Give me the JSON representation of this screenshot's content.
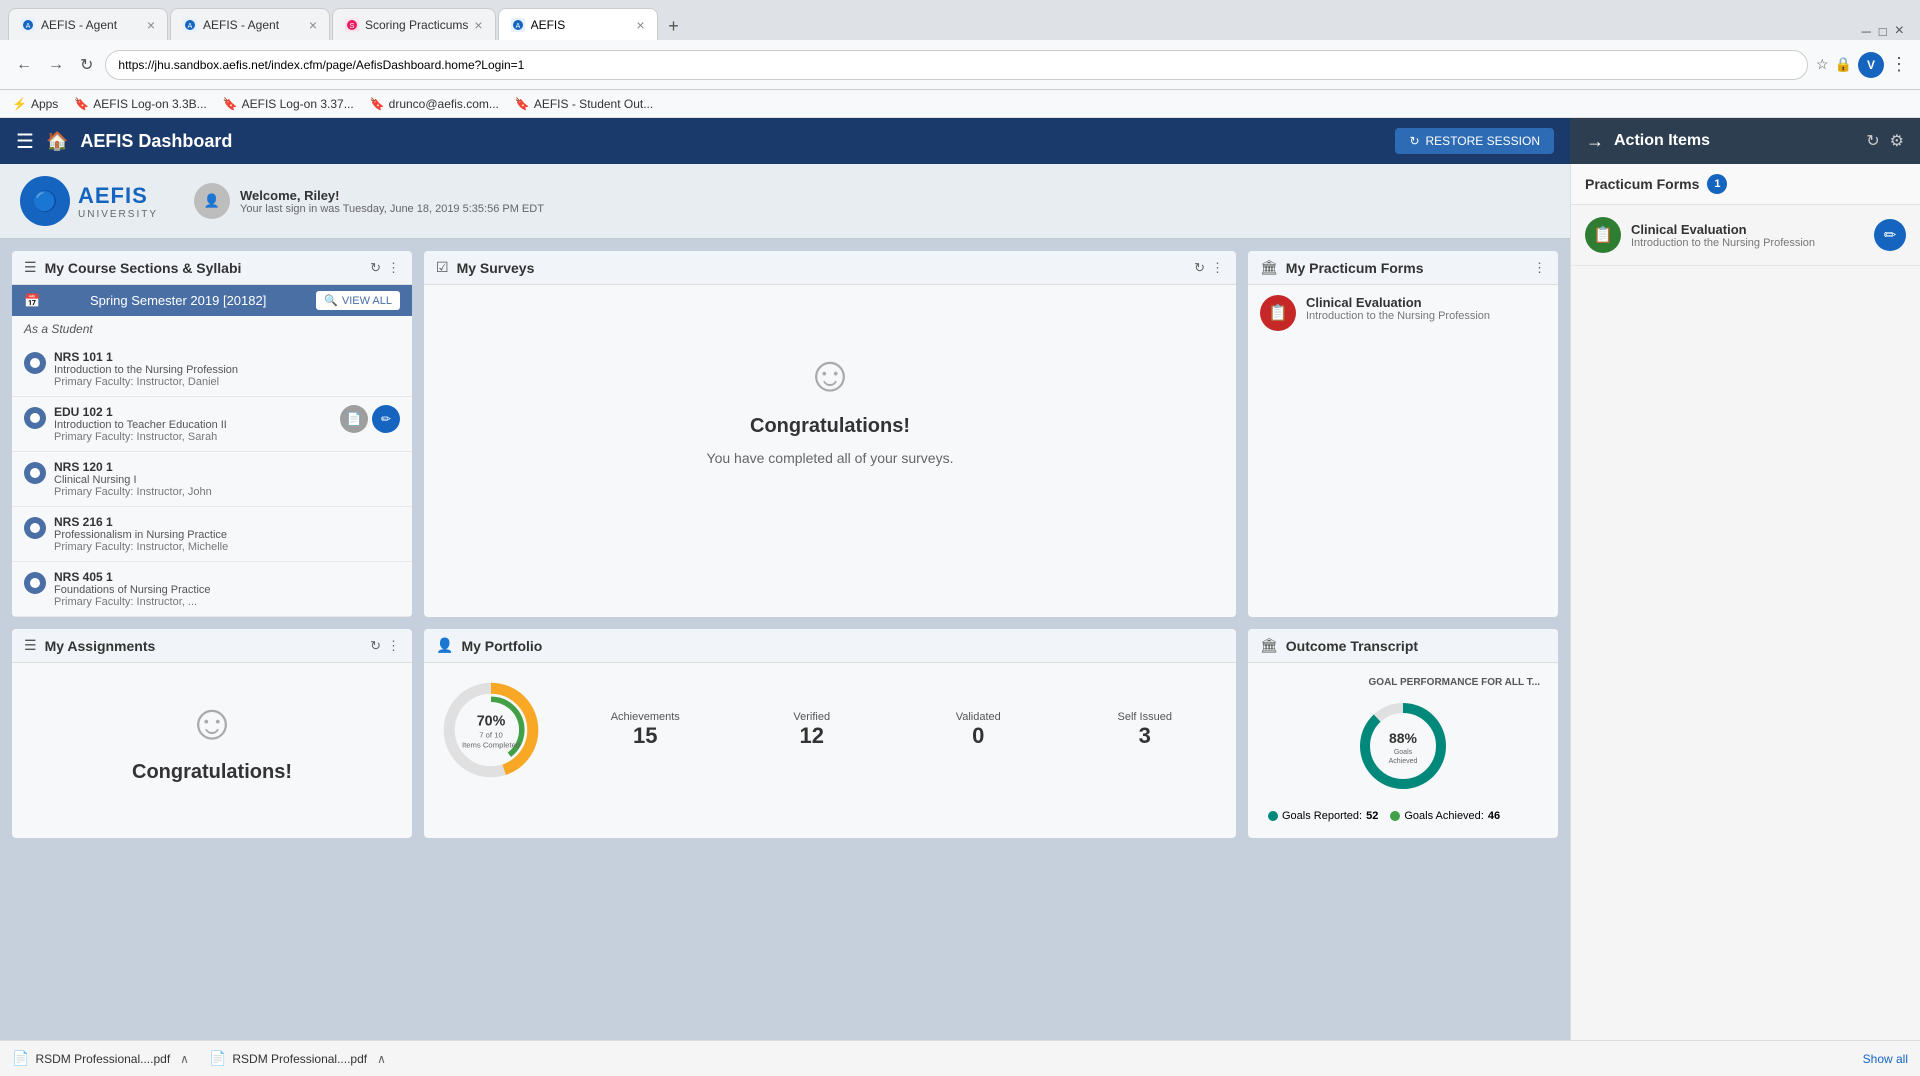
{
  "browser": {
    "tabs": [
      {
        "id": "tab1",
        "title": "AEFIS - Agent",
        "favicon_color": "#1565c0",
        "favicon_letter": "A",
        "active": false
      },
      {
        "id": "tab2",
        "title": "AEFIS - Agent",
        "favicon_color": "#1565c0",
        "favicon_letter": "A",
        "active": false
      },
      {
        "id": "tab3",
        "title": "Scoring Practicums",
        "favicon_color": "#e91e63",
        "favicon_letter": "S",
        "active": false
      },
      {
        "id": "tab4",
        "title": "AEFIS",
        "favicon_color": "#1565c0",
        "favicon_letter": "A",
        "active": true
      }
    ],
    "url": "https://jhu.sandbox.aefis.net/index.cfm/page/AefisDashboard.home?Login=1",
    "bookmarks": [
      {
        "label": "Apps",
        "icon": "⚡"
      },
      {
        "label": "AEFIS Log-on 3.3B...",
        "icon": "🔖"
      },
      {
        "label": "AEFIS Log-on 3.37...",
        "icon": "🔖"
      },
      {
        "label": "drunco@aefis.com...",
        "icon": "🔖"
      },
      {
        "label": "AEFIS - Student Out...",
        "icon": "🔖"
      }
    ]
  },
  "topnav": {
    "title": "AEFIS Dashboard",
    "restore_btn": "RESTORE SESSION"
  },
  "action_panel": {
    "title": "Action Items",
    "practicum_forms_label": "Practicum Forms",
    "practicum_forms_count": "1",
    "items": [
      {
        "title": "Clinical Evaluation",
        "subtitle": "Introduction to the Nursing Profession",
        "icon": "📋"
      }
    ]
  },
  "aefis": {
    "logo_name": "AEFIS",
    "logo_subtitle": "UNIVERSITY",
    "welcome": "Welcome, Riley!",
    "last_sign": "Your last sign in was Tuesday, June 18, 2019 5:35:56 PM EDT"
  },
  "course_sections": {
    "title": "My Course Sections & Syllabi",
    "semester": "Spring Semester 2019 [20182]",
    "view_all": "VIEW ALL",
    "as_student": "As a Student",
    "courses": [
      {
        "code": "NRS 101 1",
        "name": "Introduction to the Nursing Profession",
        "faculty_label": "Primary Faculty:",
        "faculty": "Instructor, Daniel",
        "has_doc": false,
        "has_edit": false
      },
      {
        "code": "EDU 102 1",
        "name": "Introduction to Teacher Education II",
        "faculty_label": "Primary Faculty:",
        "faculty": "Instructor, Sarah",
        "has_doc": true,
        "has_edit": true
      },
      {
        "code": "NRS 120 1",
        "name": "Clinical Nursing I",
        "faculty_label": "Primary Faculty:",
        "faculty": "Instructor, John",
        "has_doc": false,
        "has_edit": false
      },
      {
        "code": "NRS 216 1",
        "name": "Professionalism in Nursing Practice",
        "faculty_label": "Primary Faculty:",
        "faculty": "Instructor, Michelle",
        "has_doc": false,
        "has_edit": false
      },
      {
        "code": "NRS 405 1",
        "name": "Foundations of Nursing Practice",
        "faculty_label": "Primary Faculty:",
        "faculty": "Instructor, ...",
        "has_doc": false,
        "has_edit": false
      }
    ]
  },
  "surveys": {
    "title": "My Surveys",
    "congrats_title": "Congratulations!",
    "congrats_sub": "You have completed all of your surveys."
  },
  "practicum_forms": {
    "title": "My Practicum Forms",
    "items": [
      {
        "title": "Clinical Evaluation",
        "subtitle": "Introduction to the Nursing Profession"
      }
    ]
  },
  "outcome_transcript": {
    "title": "Outcome Transcript",
    "goal_label": "GOAL PERFORMANCE FOR ALL T...",
    "percentage": "88%",
    "percentage_label": "Goals\nAchieved",
    "goals_reported_label": "Goals Reported:",
    "goals_reported": "52",
    "goals_achieved_label": "Goals Achieved:",
    "goals_achieved": "46"
  },
  "assignments": {
    "title": "My Assignments",
    "congrats_title": "Congratulations!"
  },
  "portfolio": {
    "title": "My Portfolio",
    "percentage": "70%",
    "items_label": "7 of 10\nItems Completed",
    "stats": [
      {
        "label": "Achievements",
        "value": "15"
      },
      {
        "label": "Verified",
        "value": "12"
      },
      {
        "label": "Validated",
        "value": "0"
      },
      {
        "label": "Self Issued",
        "value": "3"
      }
    ]
  },
  "downloads": [
    {
      "filename": "RSDM Professional....pdf"
    },
    {
      "filename": "RSDM Professional....pdf"
    }
  ],
  "show_all": "Show all"
}
